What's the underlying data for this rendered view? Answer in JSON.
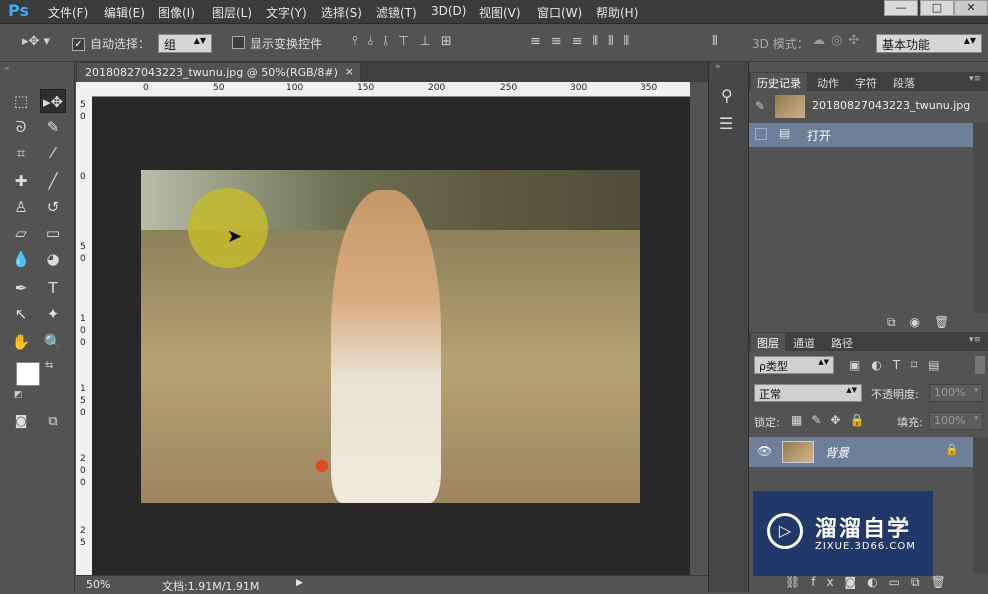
{
  "app": {
    "logo": "Ps"
  },
  "menu": [
    "文件(F)",
    "编辑(E)",
    "图像(I)",
    "图层(L)",
    "文字(Y)",
    "选择(S)",
    "滤镜(T)",
    "3D(D)",
    "视图(V)",
    "窗口(W)",
    "帮助(H)"
  ],
  "window_controls": {
    "minimize": "—",
    "maximize": "□",
    "close": "✕"
  },
  "options": {
    "auto_select_label": "自动选择：",
    "auto_select_value": "组",
    "show_transform_label": "显示变换控件",
    "mode_3d_label": "3D 模式：",
    "workspace": "基本功能"
  },
  "document": {
    "tab_title": "20180827043223_twunu.jpg @ 50%(RGB/8#)",
    "tab_close": "×",
    "ruler_top": [
      "0",
      "50",
      "100",
      "150",
      "200",
      "250",
      "300",
      "350"
    ],
    "ruler_left": [
      "5",
      "0",
      "0",
      "5",
      "0",
      "1",
      "0",
      "0",
      "1",
      "5",
      "0",
      "2",
      "0",
      "0",
      "2",
      "5"
    ],
    "zoom": "50%",
    "doc_size": "文档:1.91M/1.91M"
  },
  "history_panel": {
    "tabs": [
      "历史记录",
      "动作",
      "字符",
      "段落"
    ],
    "snapshot_name": "20180827043223_twunu.jpg",
    "items": [
      "打开"
    ]
  },
  "layers_panel": {
    "tabs": [
      "图层",
      "通道",
      "路径"
    ],
    "filter_kind": "ρ类型",
    "blend_mode": "正常",
    "opacity_label": "不透明度:",
    "opacity_value": "100%",
    "lock_label": "锁定:",
    "fill_label": "填充:",
    "fill_value": "100%",
    "layers": [
      {
        "name": "背景",
        "visible": true,
        "locked": true
      }
    ]
  },
  "watermark": {
    "brand": "溜溜自学",
    "url": "ZIXUE.3D66.COM"
  },
  "colors": {
    "accent_ps": "#3fa9f5",
    "selected_row": "#6e7f99",
    "panel_bg": "#535353",
    "canvas_bg": "#282828",
    "watermark_bg": "#20386a"
  }
}
